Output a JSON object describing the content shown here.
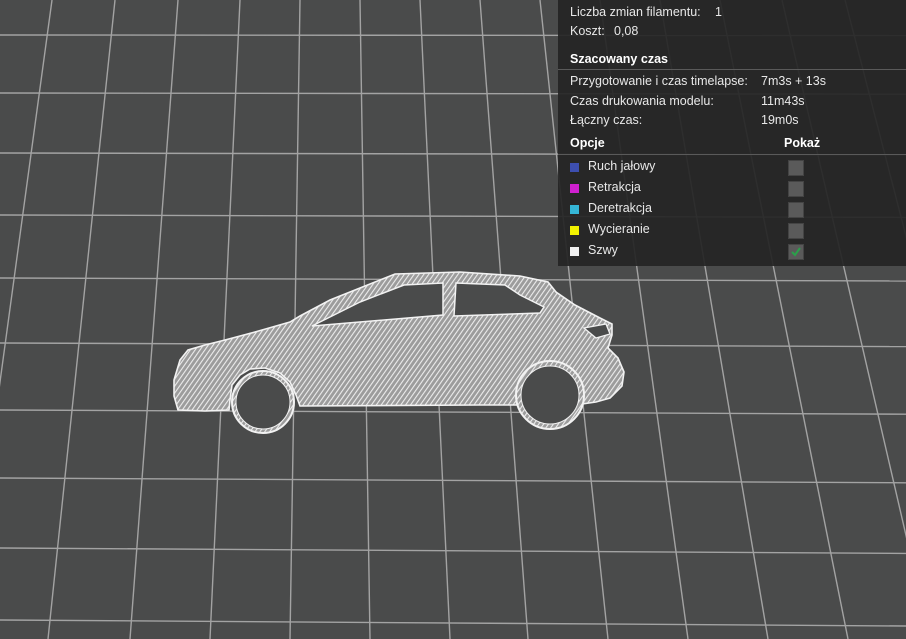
{
  "stats": {
    "filament_changes_label": "Liczba zmian filamentu:",
    "filament_changes_value": "1",
    "cost_label": "Koszt:",
    "cost_value": "0,08"
  },
  "time": {
    "header": "Szacowany czas",
    "prep_label": "Przygotowanie i czas timelapse:",
    "prep_value": "7m3s + 13s",
    "model_label": "Czas drukowania modelu:",
    "model_value": "11m43s",
    "total_label": "Łączny czas:",
    "total_value": "19m0s"
  },
  "options": {
    "header_options": "Opcje",
    "header_show": "Pokaż",
    "items": [
      {
        "label": "Ruch jałowy",
        "color": "#3d4fb0",
        "checked": false
      },
      {
        "label": "Retrakcja",
        "color": "#d020d0",
        "checked": false
      },
      {
        "label": "Deretrakcja",
        "color": "#35b6d6",
        "checked": false
      },
      {
        "label": "Wycieranie",
        "color": "#f2f200",
        "checked": false
      },
      {
        "label": "Szwy",
        "color": "#f0f0f0",
        "checked": true
      }
    ]
  },
  "colors": {
    "bed": "#4a4b4b",
    "grid": "#a7a7a7",
    "model": "#d8d8d8",
    "check": "#2aa04a"
  },
  "model_icon": "car-silhouette"
}
